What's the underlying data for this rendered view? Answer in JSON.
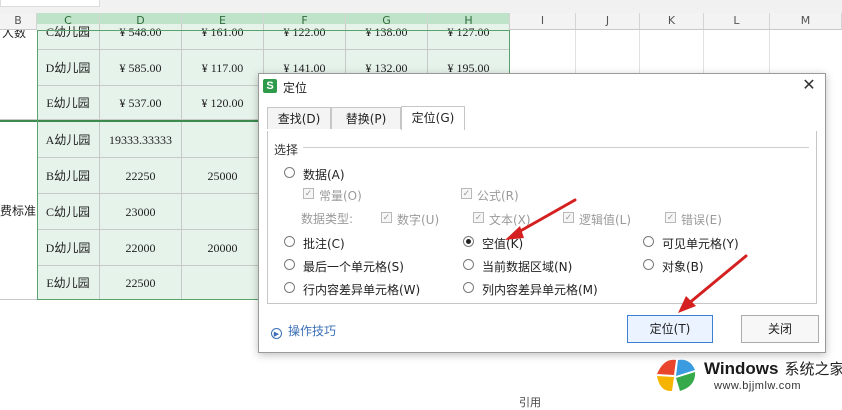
{
  "sheet": {
    "columns": [
      "B",
      "C",
      "D",
      "E",
      "F",
      "G",
      "H",
      "I",
      "J",
      "K",
      "L",
      "M"
    ],
    "rows": [
      {
        "b": "",
        "c": "C幼儿园",
        "d": "¥ 548.00",
        "e": "¥ 161.00",
        "f": "¥ 122.00",
        "g": "¥ 138.00",
        "h": "¥ 127.00"
      },
      {
        "b": "人数",
        "c": "D幼儿园",
        "d": "¥ 585.00",
        "e": "¥ 117.00",
        "f": "¥ 141.00",
        "g": "¥ 132.00",
        "h": "¥ 195.00"
      },
      {
        "b": "",
        "c": "E幼儿园",
        "d": "¥ 537.00",
        "e": "¥ 120.00",
        "f": "",
        "g": "",
        "h": ""
      },
      {
        "b": "",
        "c": "A幼儿园",
        "d": "19333.33333",
        "e": "",
        "f": "",
        "g": "",
        "h": ""
      },
      {
        "b": "",
        "c": "B幼儿园",
        "d": "22250",
        "e": "25000",
        "f": "",
        "g": "",
        "h": ""
      },
      {
        "b": "费标准",
        "c": "C幼儿园",
        "d": "23000",
        "e": "",
        "f": "",
        "g": "",
        "h": ""
      },
      {
        "b": "",
        "c": "D幼儿园",
        "d": "22000",
        "e": "20000",
        "f": "",
        "g": "",
        "h": ""
      },
      {
        "b": "",
        "c": "E幼儿园",
        "d": "22500",
        "e": "",
        "f": "",
        "g": "",
        "h": ""
      }
    ]
  },
  "dialog": {
    "app_icon": "S",
    "title": "定位",
    "close": "✕",
    "tabs": [
      "查找(D)",
      "替换(P)",
      "定位(G)"
    ],
    "group_label": "选择",
    "options": {
      "data": "数据(A)",
      "comment": "批注(C)",
      "blank": "空值(K)",
      "visible": "可见单元格(Y)",
      "last_cell": "最后一个单元格(S)",
      "current_region": "当前数据区域(N)",
      "object": "对象(B)",
      "row_diff": "行内容差异单元格(W)",
      "col_diff": "列内容差异单元格(M)"
    },
    "sub": {
      "constant": "常量(O)",
      "formula": "公式(R)",
      "data_type_label": "数据类型:",
      "number": "数字(U)",
      "text": "文本(X)",
      "logical": "逻辑值(L)",
      "error": "错误(E)",
      "check": "✓"
    },
    "tips": "操作技巧",
    "buttons": {
      "locate": "定位(T)",
      "close": "关闭"
    }
  },
  "watermark": {
    "title": "Windows",
    "subtitle": "系统之家",
    "url": "www.bjjmlw.com"
  },
  "footer_fragment": "引用",
  "colors": {
    "selected_header": "#bfe3c8",
    "selection_border": "#3c8a4e",
    "arrow": "#d42020",
    "link": "#3a6fb5"
  }
}
